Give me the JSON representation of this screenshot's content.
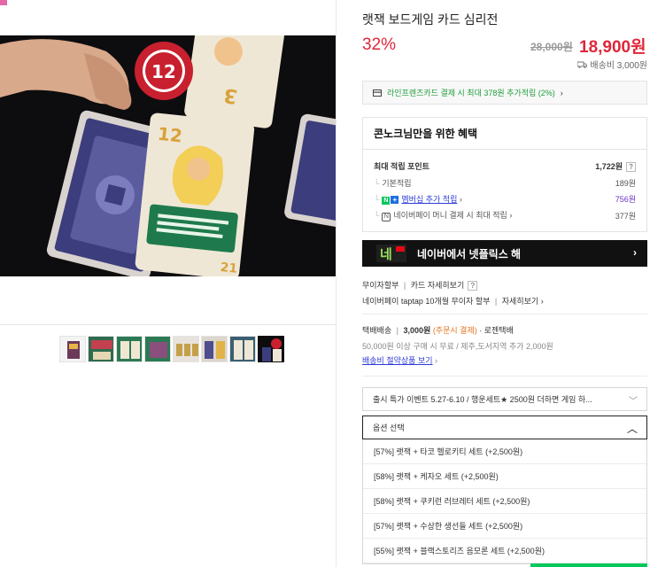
{
  "product": {
    "title": "랫잭 보드게임 카드 심리전",
    "discount": "32%",
    "original_price": "28,000원",
    "sale_price": "18,900원",
    "shipping_fee": "배송비 3,000원"
  },
  "card_banner": {
    "text": "라인프렌즈카드 결제 시 최대 378원 추가적립 (2%)",
    "arrow": "›"
  },
  "benefit": {
    "title": "콘노크님만을 위한 혜택",
    "max_points_label": "최대 적립 포인트",
    "max_points_value": "1,722원",
    "help": "?",
    "basic_label": "기본적립",
    "basic_value": "189원",
    "membership_badge_n": "N",
    "membership_badge_plus": "+",
    "membership_label": "멤버십 추가 적립",
    "membership_value": "756원",
    "npay_badge": "N",
    "npay_label": "네이버페이 머니 결제 시 최대 적립",
    "npay_value": "377원",
    "arrow": "›"
  },
  "netflix_banner": {
    "logo_text": "네",
    "text": "네이버에서 넷플릭스 해",
    "arrow": "›"
  },
  "installment": {
    "line1_a": "무이자할부",
    "line1_sep": "|",
    "line1_b": "카드 자세히보기",
    "help": "?",
    "line2_a": "네이버페이 taptap 10개월 무이자 할부",
    "line2_sep": "|",
    "line2_b": "자세히보기",
    "arrow": "›"
  },
  "delivery": {
    "type": "택배배송",
    "sep": "|",
    "fee": "3,000원",
    "pay_note": "(주문시 결제)",
    "carrier": "· 로젠택배",
    "condition": "50,000원 이상 구매 시 무료 / 제주,도서지역 추가 2,000원",
    "saving_link": "배송비 절약상품 보기",
    "arrow": "›"
  },
  "promo_select": {
    "text": "출시 특가 이벤트 5.27-6.10 / 행운세트★ 2500원 더하면 게임 하...",
    "chevron": "﹀"
  },
  "option_select": {
    "placeholder": "옵션 선택",
    "chevron": "︿",
    "options": [
      "[57%] 랫잭 + 타코 헬로키티 세트 (+2,500원)",
      "[58%] 랫잭 + 케자오 세트 (+2,500원)",
      "[58%] 랫잭 + 쿠키런 러브레터 세트 (+2,500원)",
      "[57%] 랫잭 + 수상한 생선들 세트 (+2,500원)",
      "[55%] 랫잭 + 블랙스토리즈 음모론 세트 (+2,500원)"
    ]
  },
  "colors": {
    "accent_red": "#e0263a",
    "naver_green": "#03c75a",
    "link_blue": "#2d3bd6",
    "membership_purple": "#6a35c5"
  }
}
